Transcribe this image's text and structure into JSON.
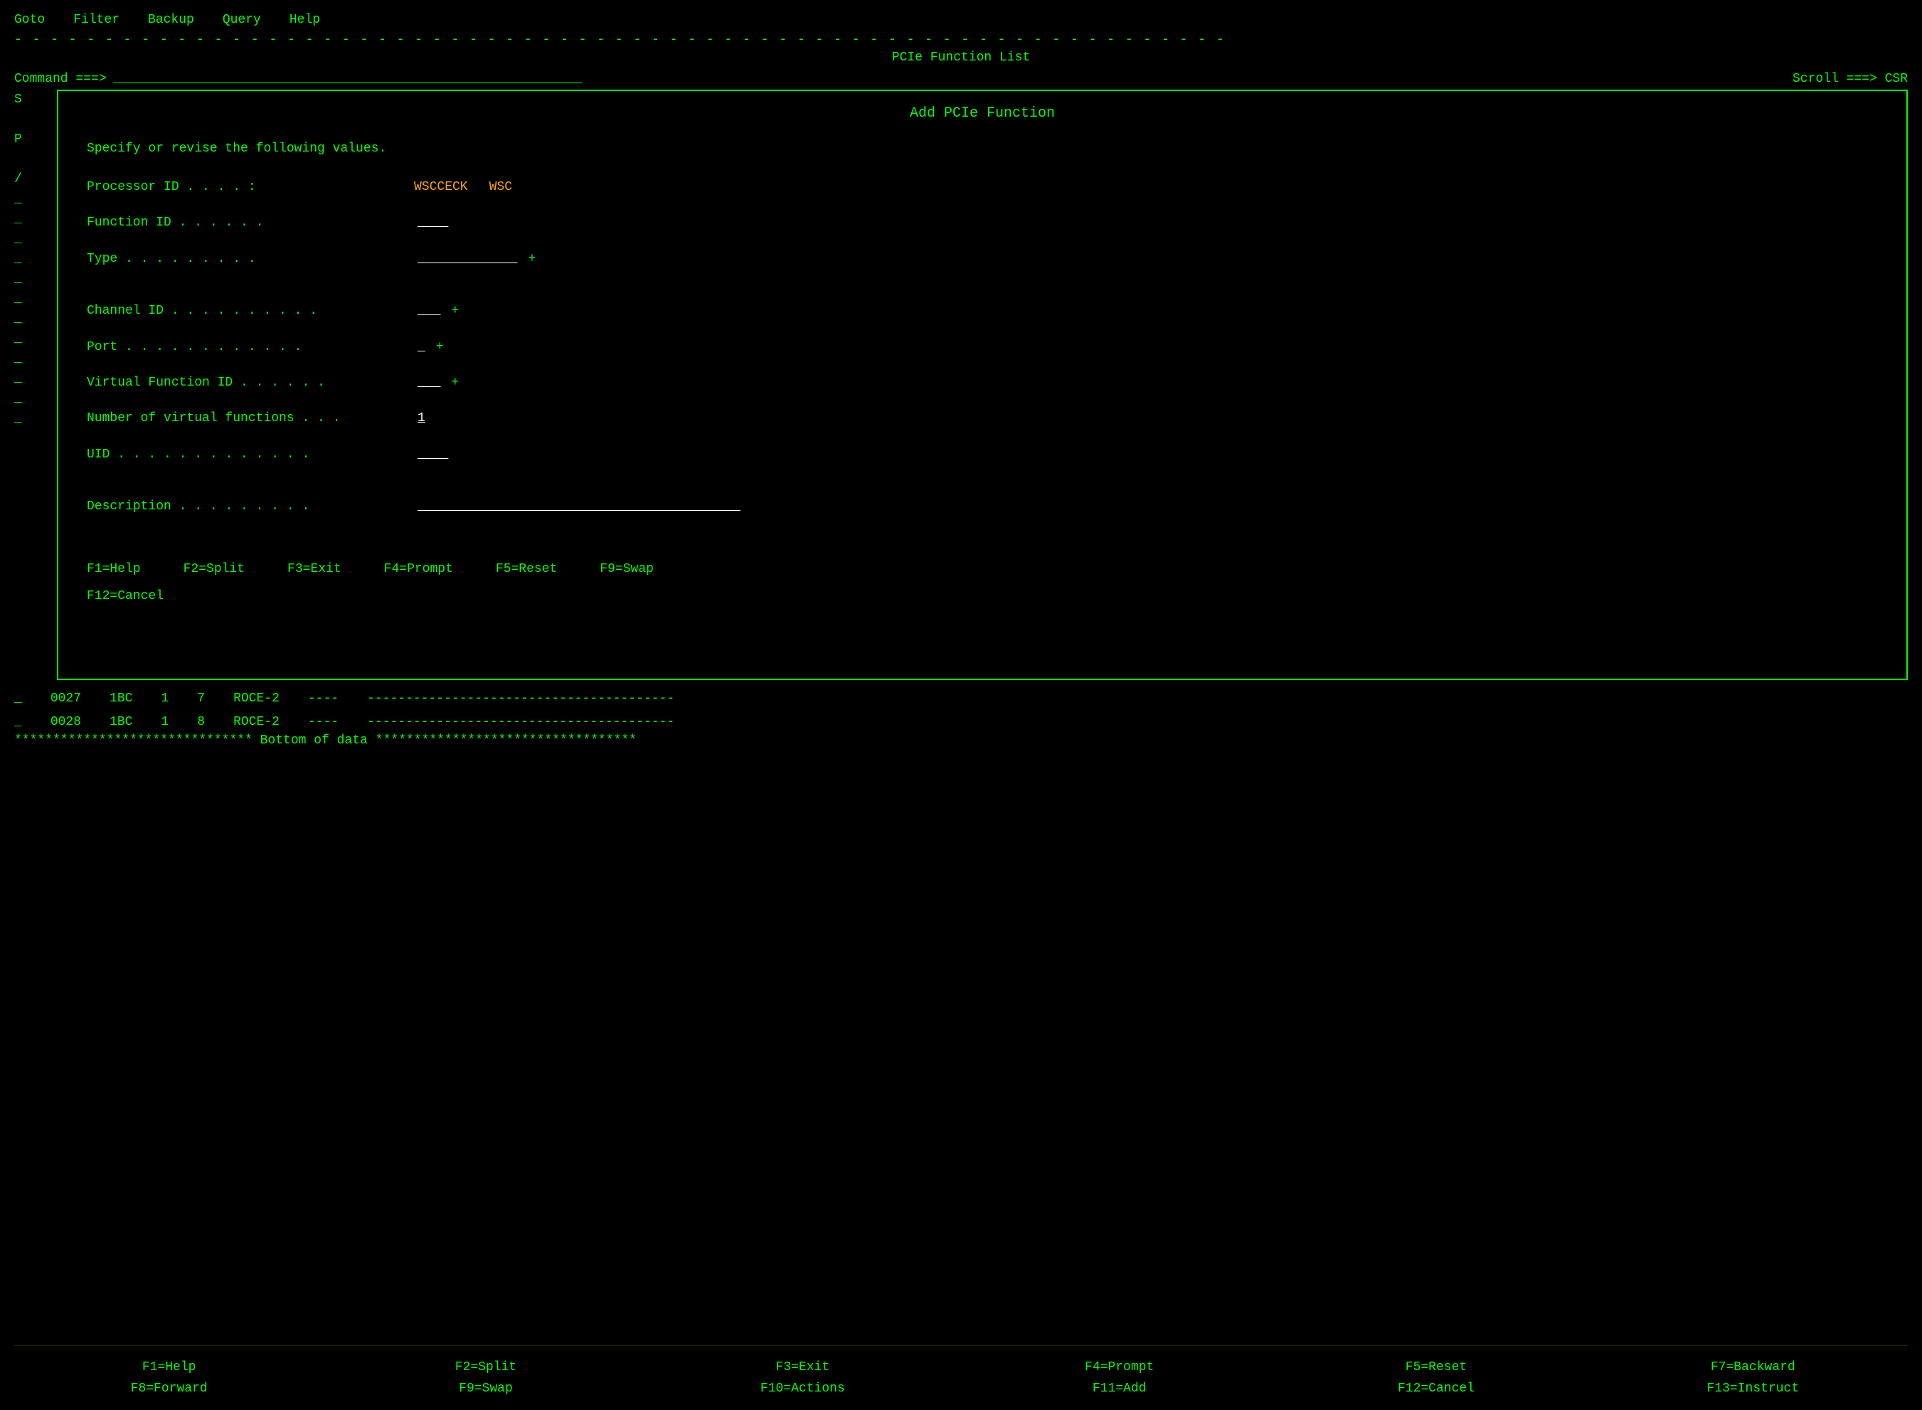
{
  "menu": {
    "items": [
      "Goto",
      "Filter",
      "Backup",
      "Query",
      "Help"
    ]
  },
  "header": {
    "title": "PCIe Function List",
    "command_label": "Command ===>",
    "command_value": "",
    "scroll_label": "Scroll ===> CSR",
    "divider": "- - - - - - - - - - - - - - - - - - - - - - - - - - - - - - - - - - - - - - - - - - - - - - - - - - - - - - - - - - - - - - - - - - -"
  },
  "left_markers": [
    "S",
    "",
    "P",
    "",
    "",
    "",
    "/",
    "",
    "_",
    "",
    "_",
    "",
    "_",
    "",
    "_",
    "",
    "_",
    "",
    "_",
    "",
    "_",
    "",
    "_"
  ],
  "modal": {
    "title": "Add PCIe Function",
    "subtitle": "Specify or revise the following values.",
    "fields": [
      {
        "label": "Processor ID  .  .  .  .  :",
        "value_orange1": "WSCCECK",
        "value_orange2": "WSC",
        "input": "",
        "has_plus": false
      },
      {
        "label": "Function ID  .  .  .  .  .  .",
        "value_orange1": "",
        "value_orange2": "",
        "input": "____",
        "has_plus": false
      },
      {
        "label": "Type  .  .  .  .  .  .  .  .  .",
        "value_orange1": "",
        "value_orange2": "",
        "input": "_____________",
        "has_plus": true
      },
      {
        "label": "Channel ID  .  .  .  .  .  .  .  .  .  .",
        "value_orange1": "",
        "value_orange2": "",
        "input": "___",
        "has_plus": true
      },
      {
        "label": "Port  .  .  .  .  .  .  .  .  .  .  .  .",
        "value_orange1": "",
        "value_orange2": "",
        "input": "_",
        "has_plus": true
      },
      {
        "label": "Virtual Function ID  .  .  .  .  .  .",
        "value_orange1": "",
        "value_orange2": "",
        "input": "___",
        "has_plus": true
      },
      {
        "label": "Number of virtual functions  .  .  .",
        "value_orange1": "",
        "value_orange2": "",
        "input": "1",
        "has_plus": false
      },
      {
        "label": "UID  .  .  .  .  .  .  .  .  .  .  .  .  .",
        "value_orange1": "",
        "value_orange2": "",
        "input": "____",
        "has_plus": false
      },
      {
        "label": "Description  .  .  .  .  .  .  .  .  .",
        "value_orange1": "",
        "value_orange2": "",
        "input": "__________________________________________",
        "has_plus": false
      }
    ],
    "fkeys_row1": [
      "F1=Help",
      "F2=Split",
      "F3=Exit",
      "F4=Prompt",
      "F5=Reset",
      "F9=Swap"
    ],
    "fkeys_row2": [
      "F12=Cancel"
    ]
  },
  "data_rows": [
    {
      "marker": "_",
      "col1": "0027",
      "col2": "1BC",
      "col3": "1",
      "col4": "7",
      "col5": "ROCE-2",
      "col6": "----",
      "col7": "----------------------------------------"
    },
    {
      "marker": "_",
      "col1": "0028",
      "col2": "1BC",
      "col3": "1",
      "col4": "8",
      "col5": "ROCE-2",
      "col6": "----",
      "col7": "----------------------------------------"
    }
  ],
  "bottom_of_data": "******************************* Bottom of data **********************************",
  "bottom_fkeys": {
    "row1": [
      "F1=Help",
      "F2=Split",
      "F3=Exit",
      "F4=Prompt",
      "F5=Reset",
      "F7=Backward"
    ],
    "row2": [
      "F8=Forward",
      "F9=Swap",
      "F10=Actions",
      "F11=Add",
      "F12=Cancel",
      "F13=Instruct"
    ]
  }
}
